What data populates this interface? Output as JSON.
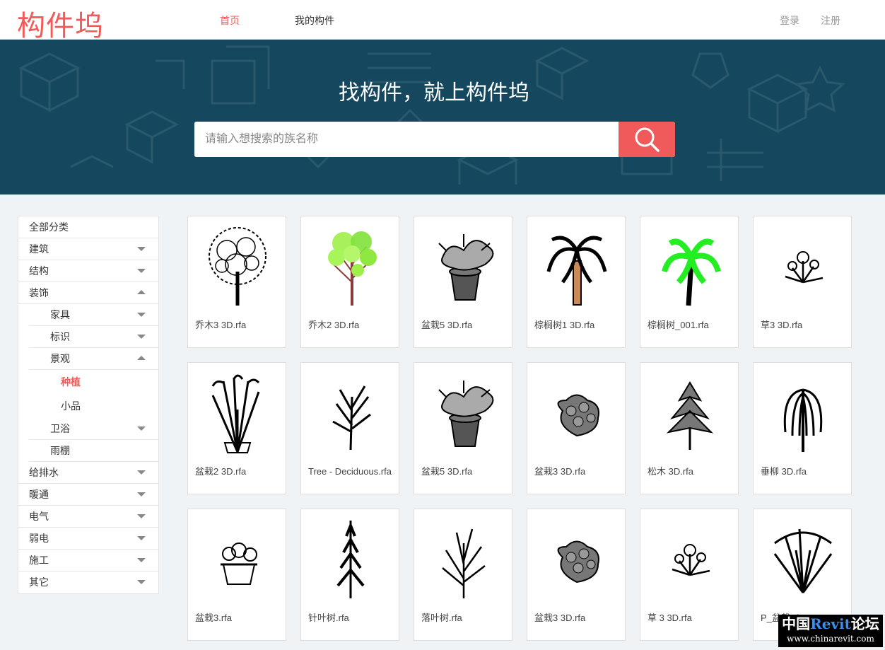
{
  "header": {
    "logo": "构件坞",
    "nav": [
      {
        "label": "首页",
        "active": true
      },
      {
        "label": "我的构件",
        "active": false
      }
    ],
    "login": "登录",
    "register": "注册"
  },
  "hero": {
    "title": "找构件，就上构件坞",
    "search_placeholder": "请输入想搜索的族名称",
    "search_value": ""
  },
  "sidebar": {
    "items": [
      {
        "label": "全部分类",
        "level": 1,
        "caret": "none"
      },
      {
        "label": "建筑",
        "level": 1,
        "caret": "down"
      },
      {
        "label": "结构",
        "level": 1,
        "caret": "down"
      },
      {
        "label": "装饰",
        "level": 1,
        "caret": "up"
      },
      {
        "label": "家具",
        "level": 2,
        "caret": "down"
      },
      {
        "label": "标识",
        "level": 2,
        "caret": "down"
      },
      {
        "label": "景观",
        "level": 2,
        "caret": "up"
      },
      {
        "label": "种植",
        "level": 3,
        "caret": "none",
        "active": true
      },
      {
        "label": "小品",
        "level": 3,
        "caret": "none"
      },
      {
        "label": "卫浴",
        "level": 2,
        "caret": "down"
      },
      {
        "label": "雨棚",
        "level": 2,
        "caret": "none"
      },
      {
        "label": "给排水",
        "level": 1,
        "caret": "down"
      },
      {
        "label": "暖通",
        "level": 1,
        "caret": "down"
      },
      {
        "label": "电气",
        "level": 1,
        "caret": "down"
      },
      {
        "label": "弱电",
        "level": 1,
        "caret": "down"
      },
      {
        "label": "施工",
        "level": 1,
        "caret": "down"
      },
      {
        "label": "其它",
        "level": 1,
        "caret": "down"
      }
    ]
  },
  "cards": [
    {
      "title": "乔木3 3D.rfa",
      "icon": "round-tree-icon"
    },
    {
      "title": "乔木2 3D.rfa",
      "icon": "green-tree-icon"
    },
    {
      "title": "盆栽5 3D.rfa",
      "icon": "potted-plant-icon"
    },
    {
      "title": "棕榈树1 3D.rfa",
      "icon": "palm-tree-icon"
    },
    {
      "title": "棕榈树_001.rfa",
      "icon": "green-palm-icon"
    },
    {
      "title": "草3 3D.rfa",
      "icon": "grass-flower-icon"
    },
    {
      "title": "盆栽2 3D.rfa",
      "icon": "tall-plant-icon"
    },
    {
      "title": "Tree - Deciduous.rfa",
      "icon": "bare-tree-icon"
    },
    {
      "title": "盆栽5 3D.rfa",
      "icon": "potted-plant-icon"
    },
    {
      "title": "盆栽3 3D.rfa",
      "icon": "shrub-icon"
    },
    {
      "title": "松木 3D.rfa",
      "icon": "pine-icon"
    },
    {
      "title": "垂柳 3D.rfa",
      "icon": "willow-icon"
    },
    {
      "title": "盆栽3.rfa",
      "icon": "flower-box-icon"
    },
    {
      "title": "针叶树.rfa",
      "icon": "conifer-icon"
    },
    {
      "title": "落叶树.rfa",
      "icon": "deciduous-icon"
    },
    {
      "title": "盆栽3 3D.rfa",
      "icon": "shrub-icon"
    },
    {
      "title": "草 3 3D.rfa",
      "icon": "grass-flower-icon"
    },
    {
      "title": "P_盆栽.rfa",
      "icon": "spiky-plant-icon"
    }
  ],
  "watermark": {
    "line1_a": "中国",
    "line1_b": "Revit",
    "line1_c": "论坛",
    "line2": "www.chinarevit.com"
  },
  "colors": {
    "accent": "#f05a5a",
    "hero_bg": "#15485f",
    "page_bg": "#eff3f5"
  }
}
